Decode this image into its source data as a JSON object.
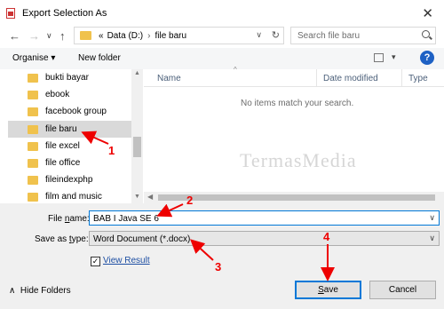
{
  "window": {
    "title": "Export Selection As",
    "close_glyph": "✕"
  },
  "nav": {
    "back": "←",
    "forward": "→",
    "recent": "∨",
    "up": "↑"
  },
  "address": {
    "prefix": "«",
    "segments": [
      "Data (D:)",
      "file baru"
    ],
    "separator": "›"
  },
  "search": {
    "placeholder": "Search file baru"
  },
  "toolbar": {
    "organise_label": "Organise ▾",
    "new_folder_label": "New folder",
    "help": "?"
  },
  "sidebar": {
    "items": [
      {
        "label": "bukti bayar"
      },
      {
        "label": "ebook"
      },
      {
        "label": "facebook group"
      },
      {
        "label": "file baru"
      },
      {
        "label": "file excel"
      },
      {
        "label": "file office"
      },
      {
        "label": "fileindexphp"
      },
      {
        "label": "film and music"
      }
    ]
  },
  "columns": {
    "name": "Name",
    "date_modified": "Date modified",
    "type": "Type"
  },
  "empty_message": "No items match your search.",
  "watermark": "TermasMedia",
  "form": {
    "file_name_label_pre": "File ",
    "file_name_label_ul": "n",
    "file_name_label_post": "ame:",
    "file_name_value": "BAB I Java SE 6",
    "save_type_label_pre": "Save as ",
    "save_type_label_ul": "t",
    "save_type_label_post": "ype:",
    "save_type_value": "Word Document (*.docx)",
    "view_result_label": "View Result",
    "view_result_check": "✓"
  },
  "footer": {
    "hide_folders_label": "Hide Folders",
    "save_ul": "S",
    "save_rest": "ave",
    "cancel_label": "Cancel"
  },
  "annotations": [
    "1",
    "2",
    "3",
    "4"
  ],
  "colors": {
    "accent": "#0078d7",
    "annotation": "#e00000",
    "folder": "#f0c24d"
  }
}
